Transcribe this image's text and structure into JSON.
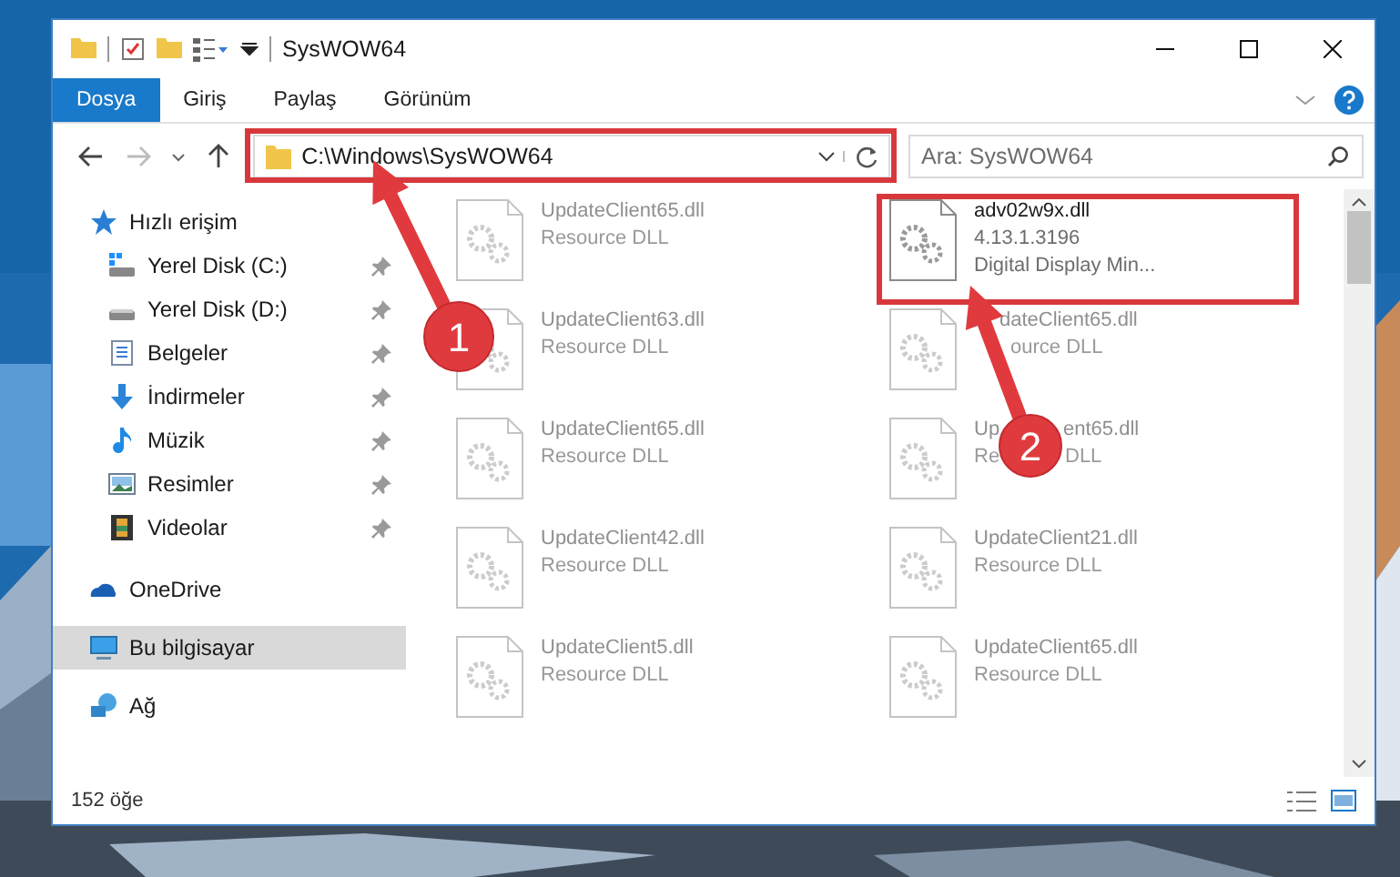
{
  "window": {
    "title": "SysWOW64"
  },
  "ribbon_tabs": [
    {
      "label": "Dosya",
      "selected": true
    },
    {
      "label": "Giriş",
      "selected": false
    },
    {
      "label": "Paylaş",
      "selected": false
    },
    {
      "label": "Görünüm",
      "selected": false
    }
  ],
  "address_bar": {
    "path": "C:\\Windows\\SysWOW64"
  },
  "search": {
    "placeholder": "Ara: SysWOW64"
  },
  "navigation": [
    {
      "kind": "star",
      "label": "Hızlı erişim",
      "selected": false,
      "children": [
        {
          "kind": "drive-c",
          "label": "Yerel Disk (C:)",
          "pinned": true,
          "selected": false
        },
        {
          "kind": "drive",
          "label": "Yerel Disk (D:)",
          "pinned": true,
          "selected": false
        },
        {
          "kind": "documents",
          "label": "Belgeler",
          "pinned": true,
          "selected": false
        },
        {
          "kind": "download",
          "label": "İndirmeler",
          "pinned": true,
          "selected": false
        },
        {
          "kind": "music",
          "label": "Müzik",
          "pinned": true,
          "selected": false
        },
        {
          "kind": "pictures",
          "label": "Resimler",
          "pinned": true,
          "selected": false
        },
        {
          "kind": "videos",
          "label": "Videolar",
          "pinned": true,
          "selected": false
        }
      ]
    },
    {
      "kind": "cloud",
      "label": "OneDrive",
      "selected": false
    },
    {
      "kind": "computer",
      "label": "Bu bilgisayar",
      "selected": true
    },
    {
      "kind": "network",
      "label": "Ağ",
      "selected": false
    }
  ],
  "files": [
    {
      "lines": [
        "UpdateClient65.dll",
        "Resource DLL"
      ],
      "faded": true
    },
    {
      "lines": [
        "adv02w9x.dll",
        "4.13.1.3196",
        "Digital Display Min..."
      ],
      "faded": false
    },
    {
      "lines": [
        "UpdateClient63.dll",
        "Resource DLL"
      ],
      "faded": true
    },
    {
      "lines": [
        [
          "dateClient65.dll"
        ],
        [
          "ource DLL"
        ]
      ],
      "faded": true
    },
    {
      "lines": [
        "UpdateClient65.dll",
        "Resource DLL"
      ],
      "faded": true
    },
    {
      "lines": [
        [
          "Up",
          "ent65.dll"
        ],
        [
          "Re",
          "DLL"
        ]
      ],
      "faded": true
    },
    {
      "lines": [
        "UpdateClient42.dll",
        "Resource DLL"
      ],
      "faded": true
    },
    {
      "lines": [
        "UpdateClient21.dll",
        "Resource DLL"
      ],
      "faded": true
    },
    {
      "lines": [
        "UpdateClient5.dll",
        "Resource DLL"
      ],
      "faded": true
    },
    {
      "lines": [
        "UpdateClient65.dll",
        "Resource DLL"
      ],
      "faded": true
    }
  ],
  "status_bar": {
    "item_count": "152 öğe"
  },
  "annotations": [
    {
      "number": "1"
    },
    {
      "number": "2"
    }
  ]
}
